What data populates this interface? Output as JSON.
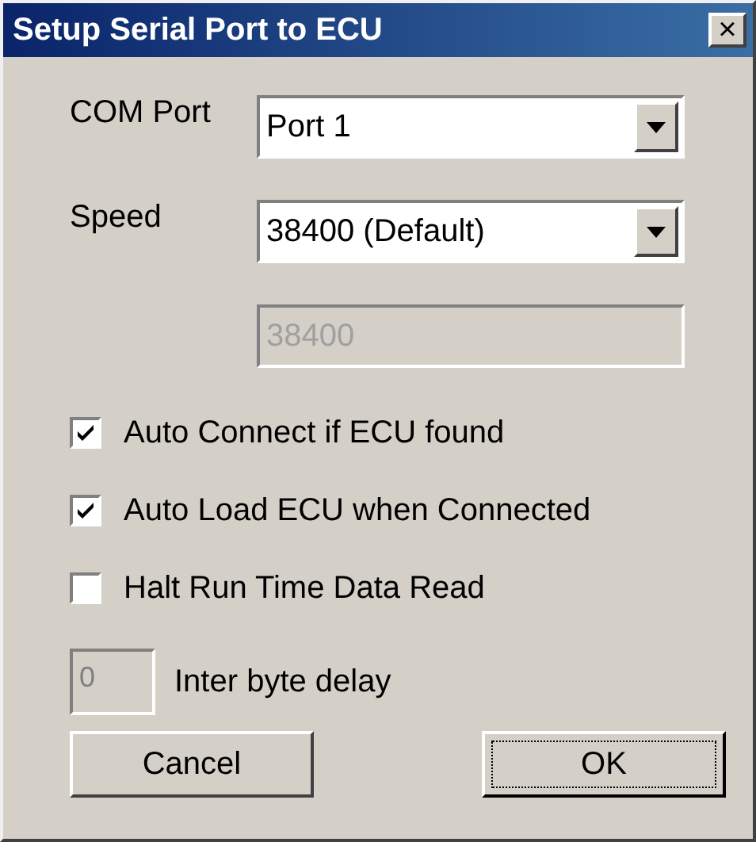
{
  "window": {
    "title": "Setup Serial Port to ECU",
    "close": "×"
  },
  "fields": [
    {
      "kind": "dropdown",
      "label": "COM Port",
      "value": "Port 1",
      "disabled": false
    },
    {
      "kind": "dropdown",
      "label": "Speed",
      "value": "38400 (Default)",
      "disabled": false
    },
    {
      "kind": "text",
      "value": "38400",
      "disabled": true
    }
  ],
  "checkboxes": [
    {
      "label": "Auto Connect if ECU found",
      "checked": true
    },
    {
      "label": "Auto Load ECU when Connected",
      "checked": true
    },
    {
      "label": "Halt Run Time Data Read",
      "checked": false
    }
  ],
  "delay": {
    "value": "0",
    "label": "Inter byte delay",
    "disabled": true
  },
  "buttons": [
    {
      "label": "Cancel",
      "focused": false
    },
    {
      "label": "OK",
      "focused": true
    }
  ]
}
